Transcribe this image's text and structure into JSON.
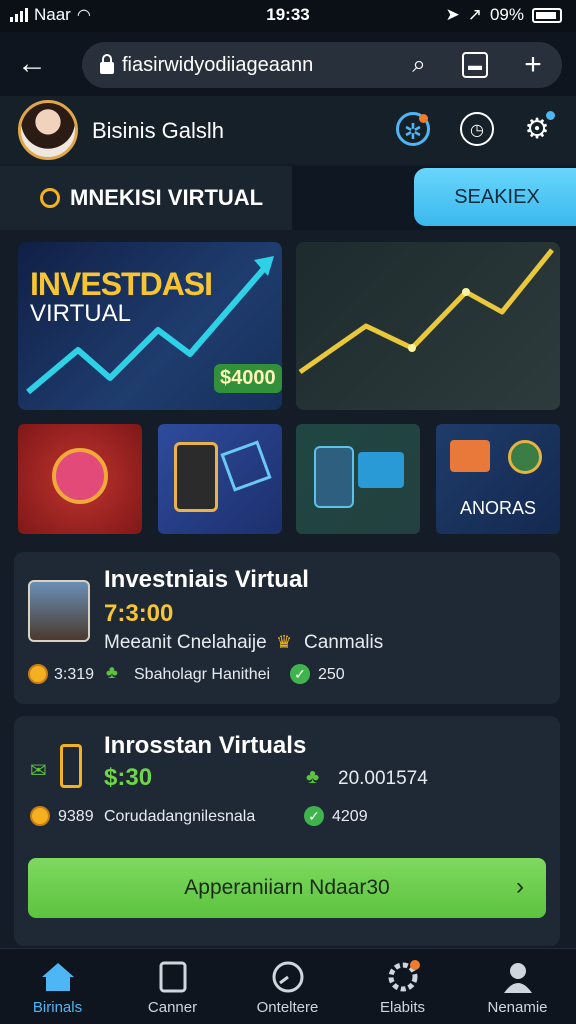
{
  "status": {
    "carrier": "Naar",
    "time": "19:33",
    "battery": "09%"
  },
  "browser": {
    "url": "fiasirwidyodiiageaann"
  },
  "profile": {
    "name": "Bisinis Galslh"
  },
  "banner": {
    "label": "MNEKISI VIRTUAL",
    "search_button": "SEAKIEX"
  },
  "hero": {
    "title": "INVESTDASI",
    "subtitle": "VIRTUAL",
    "price": "$4000"
  },
  "tiles": [
    {
      "label": ""
    },
    {
      "label": ""
    },
    {
      "label": ""
    },
    {
      "label": "ANORAS"
    }
  ],
  "card1": {
    "title": "Investniais Virtual",
    "price": "7:3:00",
    "desc": "Meeanit Cnelahaije",
    "desc2": "Canmalis",
    "stat1": "3:319",
    "stat2": "Sbaholagr Hanithei",
    "stat3": "250"
  },
  "card2": {
    "title": "Inrosstan Virtuals",
    "price": "$:30",
    "amount": "20.001574",
    "stat1": "9389",
    "stat2": "Corudadangnilesnala",
    "stat3": "4209",
    "cta": "Apperaniiarn Ndaar30"
  },
  "tabs": [
    {
      "label": "Birinals",
      "active": true
    },
    {
      "label": "Canner"
    },
    {
      "label": "Onteltere"
    },
    {
      "label": "Elabits"
    },
    {
      "label": "Nenamie"
    }
  ],
  "colors": {
    "accent": "#4fb6f5",
    "gold": "#f6c531",
    "green": "#5cc33f",
    "background": "#141d27"
  }
}
